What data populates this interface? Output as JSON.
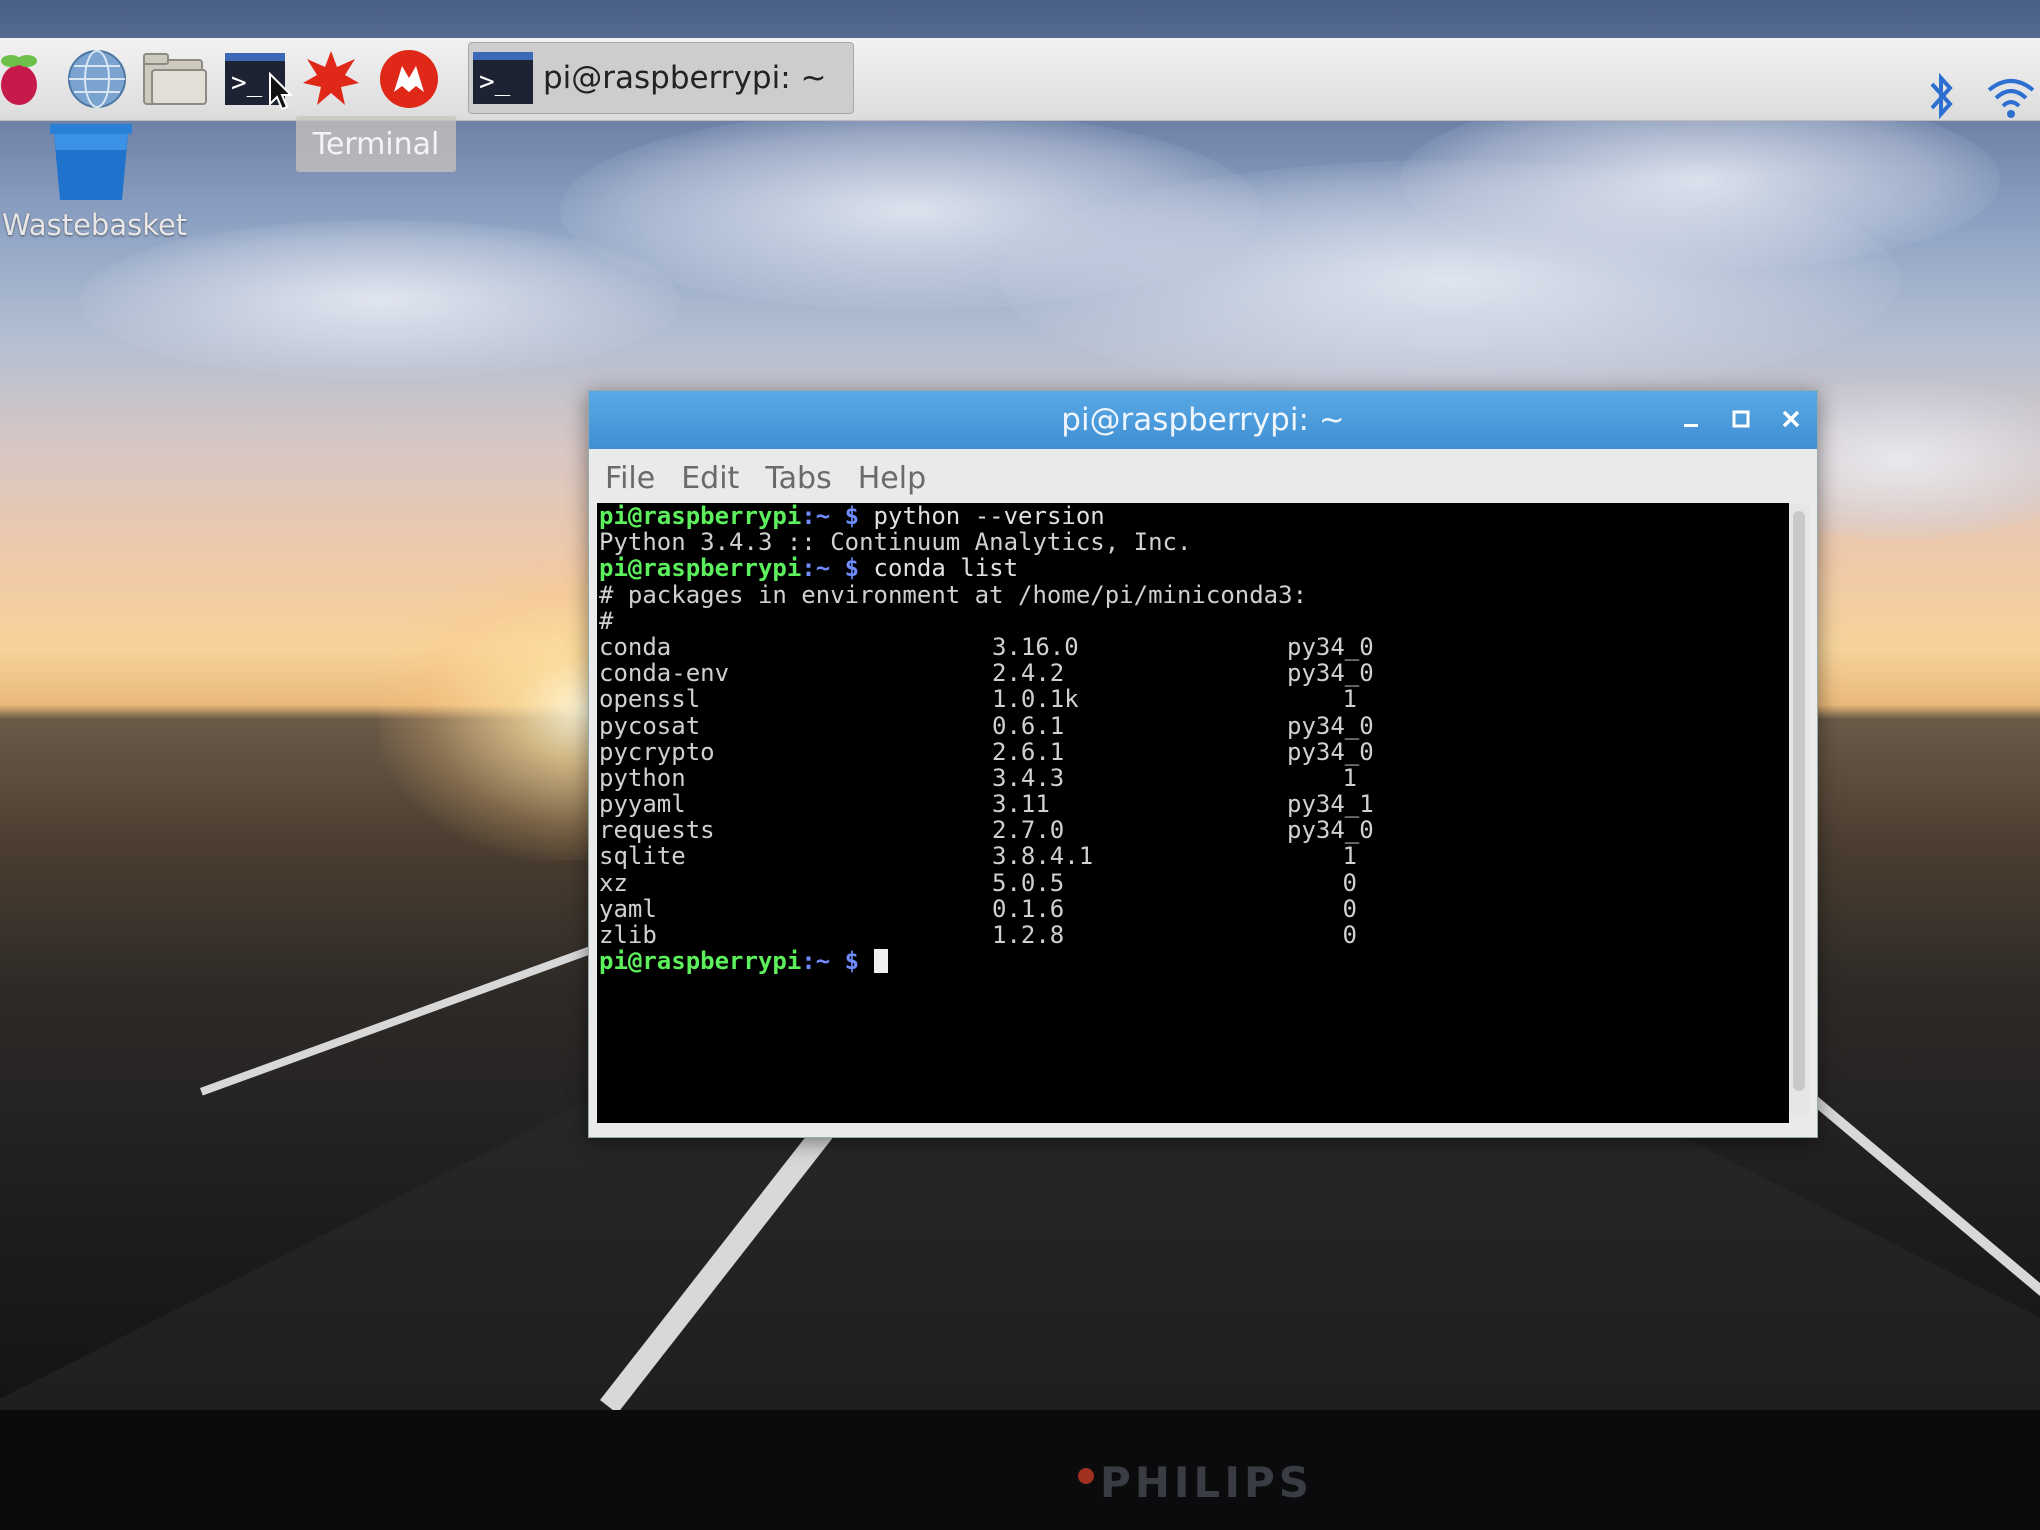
{
  "taskbar": {
    "active_task_title": "pi@raspberrypi: ~",
    "tooltip": "Terminal",
    "icons": [
      "raspberry-menu-icon",
      "browser-icon",
      "file-manager-icon",
      "terminal-icon",
      "mathematica-icon",
      "wolfram-icon"
    ]
  },
  "desktop": {
    "wastebasket_label": "Wastebasket"
  },
  "window": {
    "title": "pi@raspberrypi: ~",
    "menu": [
      "File",
      "Edit",
      "Tabs",
      "Help"
    ],
    "prompt_user": "pi@raspberrypi",
    "prompt_path": ":~ $",
    "commands": {
      "cmd1": "python --version",
      "out1": "Python 3.4.3 :: Continuum Analytics, Inc.",
      "cmd2": "conda list",
      "out2": "# packages in environment at /home/pi/miniconda3:",
      "out3": "#"
    },
    "packages": [
      {
        "name": "conda",
        "version": "3.16.0",
        "build": "py34_0"
      },
      {
        "name": "conda-env",
        "version": "2.4.2",
        "build": "py34_0"
      },
      {
        "name": "openssl",
        "version": "1.0.1k",
        "build": "1"
      },
      {
        "name": "pycosat",
        "version": "0.6.1",
        "build": "py34_0"
      },
      {
        "name": "pycrypto",
        "version": "2.6.1",
        "build": "py34_0"
      },
      {
        "name": "python",
        "version": "3.4.3",
        "build": "1"
      },
      {
        "name": "pyyaml",
        "version": "3.11",
        "build": "py34_1"
      },
      {
        "name": "requests",
        "version": "2.7.0",
        "build": "py34_0"
      },
      {
        "name": "sqlite",
        "version": "3.8.4.1",
        "build": "1"
      },
      {
        "name": "xz",
        "version": "5.0.5",
        "build": "0"
      },
      {
        "name": "yaml",
        "version": "0.1.6",
        "build": "0"
      },
      {
        "name": "zlib",
        "version": "1.2.8",
        "build": "0"
      }
    ]
  },
  "monitor": {
    "brand": "PHILIPS"
  },
  "colors": {
    "title_bar": "#4a9ddc",
    "prompt_user": "#5cf05c",
    "prompt_path": "#6f8cff"
  }
}
